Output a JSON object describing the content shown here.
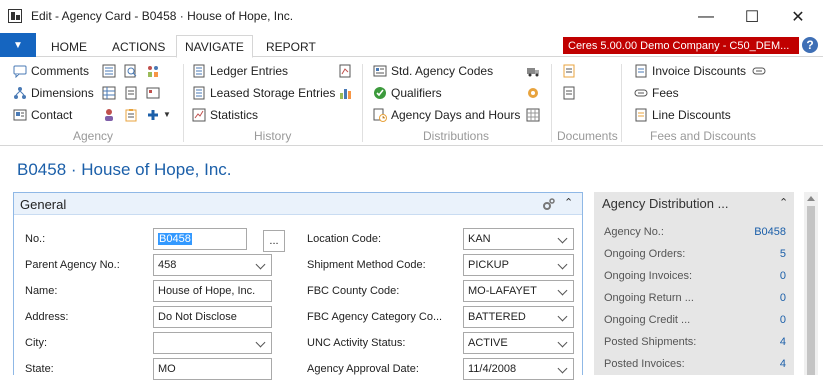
{
  "window": {
    "title": "Edit - Agency Card - B0458 · House of Hope, Inc.",
    "minimize": "—",
    "maximize": "☐",
    "close": "✕"
  },
  "ribbon_tabs": {
    "file": "▼",
    "home": "HOME",
    "actions": "ACTIONS",
    "navigate": "NAVIGATE",
    "report": "REPORT"
  },
  "company": "Ceres 5.00.00 Demo Company - C50_DEM...",
  "help": "?",
  "ribbon": {
    "agency": {
      "label": "Agency",
      "comments": "Comments",
      "dimensions": "Dimensions",
      "contact": "Contact"
    },
    "history": {
      "label": "History",
      "ledger_entries": "Ledger Entries",
      "leased_storage": "Leased Storage Entries",
      "statistics": "Statistics"
    },
    "distributions": {
      "label": "Distributions",
      "std_agency_codes": "Std. Agency Codes",
      "qualifiers": "Qualifiers",
      "days_hours": "Agency Days and Hours"
    },
    "documents": {
      "label": "Documents"
    },
    "fees": {
      "label": "Fees and Discounts",
      "invoice_discounts": "Invoice Discounts",
      "fees": "Fees",
      "line_discounts": "Line Discounts"
    }
  },
  "page_title": "B0458 · House of Hope, Inc.",
  "general": {
    "title": "General",
    "left": [
      {
        "label": "No.:",
        "value": "B0458"
      },
      {
        "label": "Parent Agency No.:",
        "value": "458"
      },
      {
        "label": "Name:",
        "value": "House of Hope, Inc."
      },
      {
        "label": "Address:",
        "value": "Do Not Disclose"
      },
      {
        "label": "City:",
        "value": ""
      },
      {
        "label": "State:",
        "value": "MO"
      }
    ],
    "right": [
      {
        "label": "Location Code:",
        "value": "KAN"
      },
      {
        "label": "Shipment Method Code:",
        "value": "PICKUP"
      },
      {
        "label": "FBC County Code:",
        "value": "MO-LAFAYET"
      },
      {
        "label": "FBC Agency Category Co...",
        "value": "BATTERED"
      },
      {
        "label": "UNC Activity Status:",
        "value": "ACTIVE"
      },
      {
        "label": "Agency Approval Date:",
        "value": "11/4/2008"
      }
    ],
    "lookup": "..."
  },
  "factbox": {
    "title": "Agency Distribution ...",
    "rows": [
      {
        "label": "Agency No.:",
        "value": "B0458"
      },
      {
        "label": "Ongoing Orders:",
        "value": "5"
      },
      {
        "label": "Ongoing Invoices:",
        "value": "0"
      },
      {
        "label": "Ongoing Return ...",
        "value": "0"
      },
      {
        "label": "Ongoing Credit ...",
        "value": "0"
      },
      {
        "label": "Posted Shipments:",
        "value": "4"
      },
      {
        "label": "Posted Invoices:",
        "value": "4"
      }
    ]
  }
}
